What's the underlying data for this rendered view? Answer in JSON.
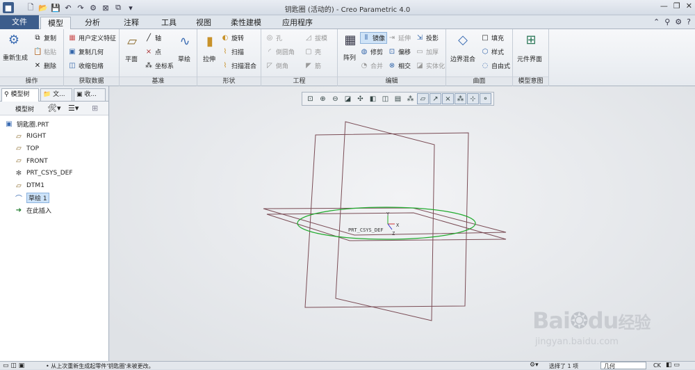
{
  "window": {
    "title": "钥匙圈 (活动的) - Creo Parametric 4.0"
  },
  "tabs": [
    "文件",
    "模型",
    "分析",
    "注释",
    "工具",
    "视图",
    "柔性建模",
    "应用程序"
  ],
  "ribbon": {
    "ops": {
      "regen": "重新生成",
      "copy": "复制",
      "paste": "粘贴",
      "delete": "删除",
      "label": "操作"
    },
    "getdata": {
      "udf": "用户定义特征",
      "copygeom": "复制几何",
      "shrink": "收缩包络",
      "label": "获取数据"
    },
    "datum": {
      "plane": "平面",
      "axis": "轴",
      "point": "点",
      "csys": "坐标系",
      "sketch": "草绘",
      "label": "基准"
    },
    "shapes": {
      "extrude": "拉伸",
      "revolve": "旋转",
      "sweep": "扫描",
      "swept_blend": "扫描混合",
      "label": "形状"
    },
    "eng": {
      "hole": "孔",
      "draft": "拔模",
      "round": "倒圆角",
      "shell": "壳",
      "chamfer": "倒角",
      "rib": "筋",
      "label": "工程"
    },
    "edit": {
      "pattern": "阵列",
      "mirror": "镜像",
      "extend": "延伸",
      "project": "投影",
      "trim": "修剪",
      "offset": "偏移",
      "thicken": "加厚",
      "merge": "合并",
      "intersect": "相交",
      "solidify": "实体化",
      "label": "编辑"
    },
    "surf": {
      "boundary": "边界混合",
      "fill": "填充",
      "style": "样式",
      "freestyle": "自由式",
      "label": "曲面"
    },
    "intent": {
      "element": "元件界面",
      "label": "模型意图"
    }
  },
  "left": {
    "tabs": [
      "模型树",
      "文...",
      "收..."
    ],
    "toolbar_label": "模型树",
    "tree": [
      {
        "icon": "part-icon",
        "label": "钥匙圈.PRT"
      },
      {
        "icon": "plane-icon",
        "label": "RIGHT"
      },
      {
        "icon": "plane-icon",
        "label": "TOP"
      },
      {
        "icon": "plane-icon",
        "label": "FRONT"
      },
      {
        "icon": "csys-icon",
        "label": "PRT_CSYS_DEF"
      },
      {
        "icon": "plane-icon",
        "label": "DTM1"
      },
      {
        "icon": "sketch-icon",
        "label": "草绘 1"
      },
      {
        "icon": "insert-icon",
        "label": "在此插入"
      }
    ]
  },
  "viewport": {
    "csys_label": "PRT_CSYS_DEF",
    "x": "X",
    "y": "Y",
    "z": "Z"
  },
  "status": {
    "message": "• 从上次重新生成起零件'钥匙圈'未被更改。",
    "selected": "选择了 1 项",
    "filter": "几何",
    "ck": "CK"
  },
  "watermark": {
    "brand": "Bai",
    "du": "du",
    "cn": "经验",
    "url": "jingyan.baidu.com"
  },
  "colors": {
    "file_tab": "#3c5d8c",
    "sketch": "#1faa2c",
    "plane": "#7a4c55"
  }
}
